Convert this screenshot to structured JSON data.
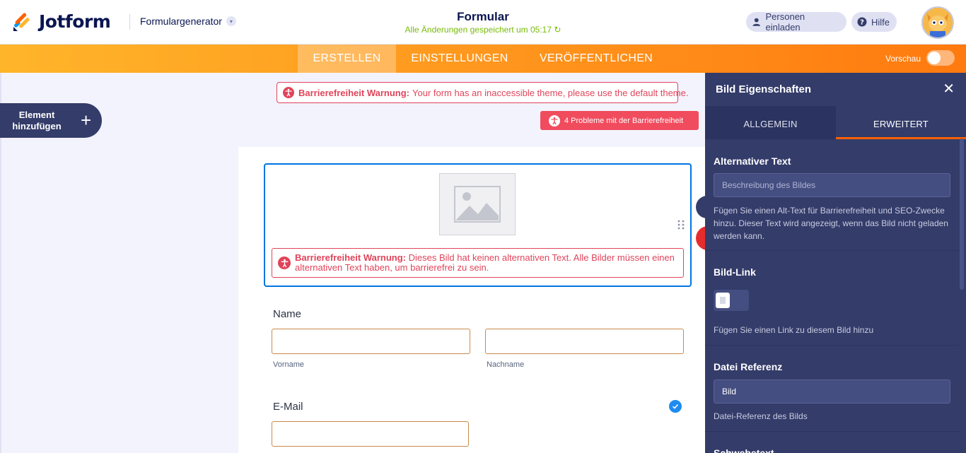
{
  "header": {
    "logo_text": "Jotform",
    "generator_label": "Formulargenerator",
    "form_title": "Formular",
    "saved_status": "Alle Änderungen gespeichert um 05:17",
    "invite_label": "Personen einladen",
    "help_label": "Hilfe"
  },
  "nav": {
    "tabs": [
      {
        "label": "ERSTELLEN",
        "active": true
      },
      {
        "label": "EINSTELLUNGEN",
        "active": false
      },
      {
        "label": "VERÖFFENTLICHEN",
        "active": false
      }
    ],
    "preview_label": "Vorschau"
  },
  "left": {
    "add_element_label": "Element hinzufügen"
  },
  "warnings": {
    "banner_bold": "Barrierefreiheit Warnung:",
    "banner_text": "Your form has an inaccessible theme, please use the default theme.",
    "issues_button": "4 Probleme mit der Barrierefreiheit",
    "image_bold": "Barrierefreiheit Warnung:",
    "image_text": "Dieses Bild hat keinen alternativen Text. Alle Bilder müssen einen alternativen Text haben, um barrierefrei zu sein."
  },
  "form": {
    "name_label": "Name",
    "first_name_sub": "Vorname",
    "last_name_sub": "Nachname",
    "email_label": "E-Mail"
  },
  "props": {
    "title": "Bild Eigenschaften",
    "tabs": [
      "ALLGEMEIN",
      "ERWEITERT"
    ],
    "alt_text": {
      "title": "Alternativer Text",
      "placeholder": "Beschreibung des Bildes",
      "description": "Fügen Sie einen Alt-Text für Barrierefreiheit und SEO-Zwecke hinzu. Dieser Text wird angezeigt, wenn das Bild nicht geladen werden kann."
    },
    "image_link": {
      "title": "Bild-Link",
      "description": "Fügen Sie einen Link zu diesem Bild hinzu"
    },
    "file_ref": {
      "title": "Datei Referenz",
      "value": "Bild",
      "description": "Datei-Referenz des Bilds"
    },
    "hover_text": {
      "title": "Schwebetext"
    }
  },
  "colors": {
    "brand_orange": "#ff7a0f",
    "panel_navy": "#343c6a",
    "warning_red": "#e0445a",
    "accent_blue": "#0075e3"
  }
}
